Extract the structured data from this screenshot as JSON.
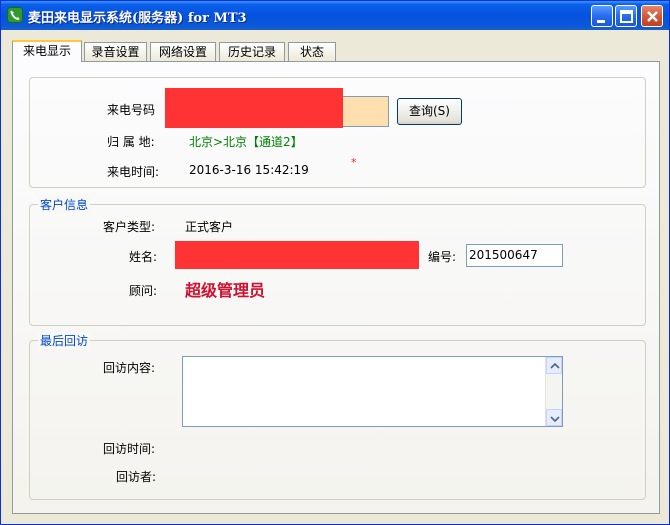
{
  "window": {
    "title": "麦田来电显示系统(服务器) for MT3",
    "controls": {
      "minimize": "minimize",
      "maximize": "maximize",
      "close": "close"
    }
  },
  "tabs": [
    {
      "label": "来电显示",
      "active": true
    },
    {
      "label": "录音设置",
      "active": false
    },
    {
      "label": "网络设置",
      "active": false
    },
    {
      "label": "历史记录",
      "active": false
    },
    {
      "label": "状态",
      "active": false
    }
  ],
  "call": {
    "number_label": "来电号码",
    "number_value": "",
    "query_button": "查询(S)",
    "location_label": "归 属 地:",
    "location_value": "北京>北京【通道2】",
    "time_label": "来电时间:",
    "time_value": "2016-3-16 15:42:19",
    "marker": "*"
  },
  "customer": {
    "group_title": "客户信息",
    "type_label": "客户类型:",
    "type_value": "正式客户",
    "name_label": "姓名:",
    "name_value": "",
    "id_label": "编号:",
    "id_value": "201500647",
    "advisor_label": "顾问:",
    "advisor_value": "超级管理员"
  },
  "followup": {
    "group_title": "最后回访",
    "content_label": "回访内容:",
    "content_value": "",
    "time_label": "回访时间:",
    "time_value": "",
    "person_label": "回访者:",
    "person_value": ""
  },
  "colors": {
    "redaction": "#ff3333",
    "location_text": "#008000",
    "advisor_text": "#d01030",
    "group_title": "#0046d5",
    "number_field_bg": "#ffdfb0"
  },
  "icons": {
    "app": "phone-icon",
    "scroll_up": "arrow-up-icon",
    "scroll_down": "arrow-down-icon"
  }
}
